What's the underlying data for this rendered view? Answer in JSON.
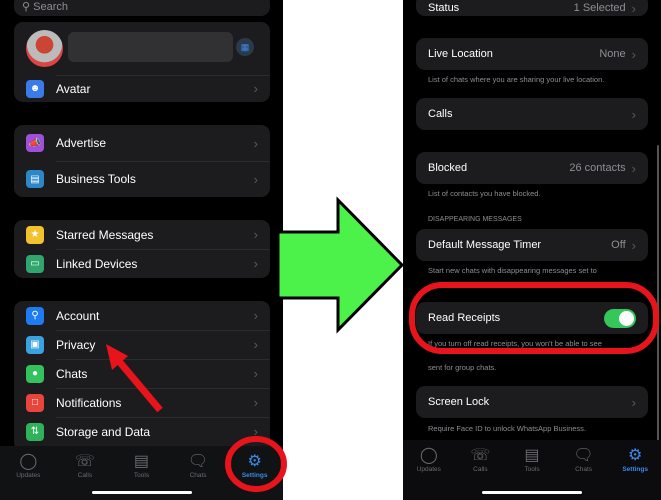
{
  "left": {
    "search_placeholder": "Search",
    "profile_name": "",
    "groups": [
      [
        {
          "label": "Avatar",
          "icon": "avatar-icon",
          "color": "#3a7bea"
        }
      ],
      [
        {
          "label": "Advertise",
          "icon": "megaphone-icon",
          "color": "#a04fd8"
        },
        {
          "label": "Business Tools",
          "icon": "storefront-icon",
          "color": "#2b87c7"
        }
      ],
      [
        {
          "label": "Starred Messages",
          "icon": "star-icon",
          "color": "#f2c12e"
        },
        {
          "label": "Linked Devices",
          "icon": "laptop-icon",
          "color": "#2fa66b"
        }
      ],
      [
        {
          "label": "Account",
          "icon": "key-icon",
          "color": "#1f7bf2"
        },
        {
          "label": "Privacy",
          "icon": "lock-icon",
          "color": "#3aa2e0"
        },
        {
          "label": "Chats",
          "icon": "chat-bubble-icon",
          "color": "#33c25c"
        },
        {
          "label": "Notifications",
          "icon": "notification-icon",
          "color": "#e8453c"
        },
        {
          "label": "Storage and Data",
          "icon": "arrows-updown-icon",
          "color": "#2fb35a"
        }
      ]
    ]
  },
  "tabs": [
    {
      "label": "Updates",
      "icon": "updates-icon"
    },
    {
      "label": "Calls",
      "icon": "phone-icon"
    },
    {
      "label": "Tools",
      "icon": "tools-icon"
    },
    {
      "label": "Chats",
      "icon": "chats-icon"
    },
    {
      "label": "Settings",
      "icon": "settings-gear-icon",
      "active": true
    }
  ],
  "right": {
    "status": {
      "label": "Status",
      "value": "1 Selected"
    },
    "live_location": {
      "label": "Live Location",
      "value": "None",
      "footnote": "List of chats where you are sharing your live location."
    },
    "calls": {
      "label": "Calls"
    },
    "blocked": {
      "label": "Blocked",
      "value": "26 contacts",
      "footnote": "List of contacts you have blocked."
    },
    "section_header": "DISAPPEARING MESSAGES",
    "default_timer": {
      "label": "Default Message Timer",
      "value": "Off",
      "footnote": "Start new chats with disappearing messages set to"
    },
    "read_receipts": {
      "label": "Read Receipts",
      "enabled": true,
      "footnote1": "If you turn off read receipts, you won't be able to see",
      "footnote2": "sent for group chats."
    },
    "screen_lock": {
      "label": "Screen Lock",
      "footnote": "Require Face ID to unlock WhatsApp Business."
    }
  },
  "colors": {
    "annotation_red": "#e8141b",
    "arrow_green": "#4cf24a",
    "toggle_green": "#34c759",
    "accent_blue": "#3a8be8"
  }
}
